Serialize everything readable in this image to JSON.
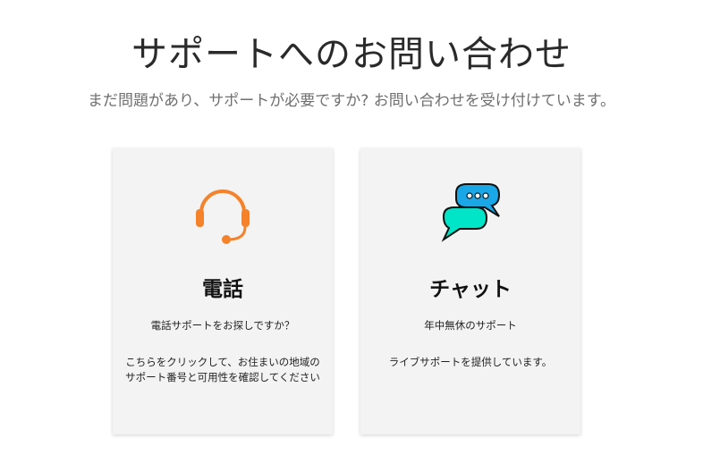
{
  "header": {
    "title": "サポートへのお問い合わせ",
    "subtitle": "まだ問題があり、サポートが必要ですか? お問い合わせを受け付けています。"
  },
  "cards": [
    {
      "icon": "headset-icon",
      "heading": "電話",
      "line1": "電話サポートをお探しですか？",
      "line2": "こちらをクリックして、お住まいの地域のサポート番号と可用性を確認してください"
    },
    {
      "icon": "chat-bubbles-icon",
      "heading": "チャット",
      "line1": "年中無休のサポート",
      "line2": "ライブサポートを提供しています。"
    }
  ],
  "colors": {
    "headset": "#f5822a",
    "chat_back": "#1aa7e8",
    "chat_front": "#00e5c8",
    "card_bg": "#f3f3f3"
  }
}
